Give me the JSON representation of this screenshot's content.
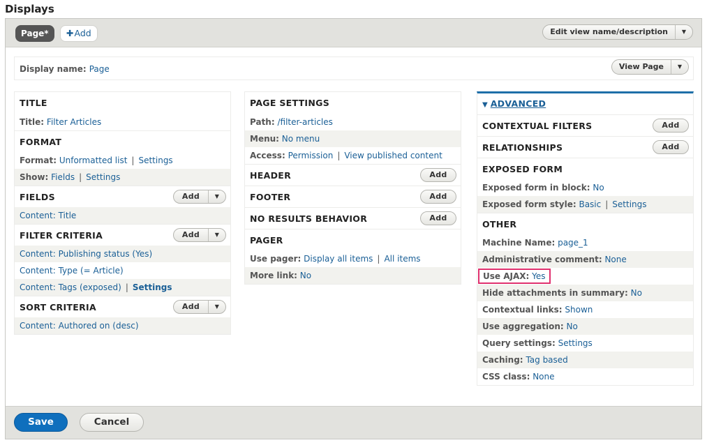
{
  "page_heading": "Displays",
  "tabs": {
    "active": "Page*",
    "add_plus": "✚",
    "add_label": "Add"
  },
  "edit_view": {
    "label": "Edit view name/description",
    "dropdown": "▼"
  },
  "display_name": {
    "label": "Display name:",
    "value": "Page"
  },
  "view_page": {
    "label": "View Page",
    "dropdown": "▼"
  },
  "column1": {
    "title": {
      "heading": "TITLE",
      "key": "Title:",
      "value": "Filter Articles"
    },
    "format": {
      "heading": "FORMAT",
      "format_key": "Format:",
      "format_value": "Unformatted list",
      "format_settings": "Settings",
      "show_key": "Show:",
      "show_value": "Fields",
      "show_settings": "Settings"
    },
    "fields": {
      "heading": "FIELDS",
      "add": "Add",
      "items": [
        "Content: Title"
      ]
    },
    "filter_criteria": {
      "heading": "FILTER CRITERIA",
      "add": "Add",
      "items": [
        "Content: Publishing status (Yes)",
        "Content: Type (= Article)",
        "Content: Tags (exposed)"
      ],
      "tags_settings": "Settings"
    },
    "sort_criteria": {
      "heading": "SORT CRITERIA",
      "add": "Add",
      "items": [
        "Content: Authored on (desc)"
      ]
    }
  },
  "column2": {
    "page_settings": {
      "heading": "PAGE SETTINGS",
      "path_key": "Path:",
      "path_value": "/filter-articles",
      "menu_key": "Menu:",
      "menu_value": "No menu",
      "access_key": "Access:",
      "access_value": "Permission",
      "access_detail": "View published content"
    },
    "header": {
      "heading": "HEADER",
      "add": "Add"
    },
    "footer": {
      "heading": "FOOTER",
      "add": "Add"
    },
    "no_results": {
      "heading": "NO RESULTS BEHAVIOR",
      "add": "Add"
    },
    "pager": {
      "heading": "PAGER",
      "use_pager_key": "Use pager:",
      "use_pager_value": "Display all items",
      "use_pager_detail": "All items",
      "more_link_key": "More link:",
      "more_link_value": "No"
    }
  },
  "column3": {
    "advanced": {
      "triangle": "▼",
      "label": "ADVANCED"
    },
    "contextual_filters": {
      "heading": "CONTEXTUAL FILTERS",
      "add": "Add"
    },
    "relationships": {
      "heading": "RELATIONSHIPS",
      "add": "Add"
    },
    "exposed_form": {
      "heading": "EXPOSED FORM",
      "in_block_key": "Exposed form in block:",
      "in_block_value": "No",
      "style_key": "Exposed form style:",
      "style_value": "Basic",
      "style_settings": "Settings"
    },
    "other": {
      "heading": "OTHER",
      "rows": [
        {
          "key": "Machine Name:",
          "value": "page_1"
        },
        {
          "key": "Administrative comment:",
          "value": "None"
        },
        {
          "key": "Use AJAX:",
          "value": "Yes",
          "highlighted": true
        },
        {
          "key": "Hide attachments in summary:",
          "value": "No"
        },
        {
          "key": "Contextual links:",
          "value": "Shown"
        },
        {
          "key": "Use aggregation:",
          "value": "No"
        },
        {
          "key": "Query settings:",
          "value": "Settings"
        },
        {
          "key": "Caching:",
          "value": "Tag based"
        },
        {
          "key": "CSS class:",
          "value": "None"
        }
      ]
    }
  },
  "footer": {
    "save": "Save",
    "cancel": "Cancel"
  },
  "colors": {
    "link": "#1a5f96",
    "accent": "#1e6fa8",
    "save_button": "#0f6fbd",
    "highlight_border": "#e0306e"
  }
}
